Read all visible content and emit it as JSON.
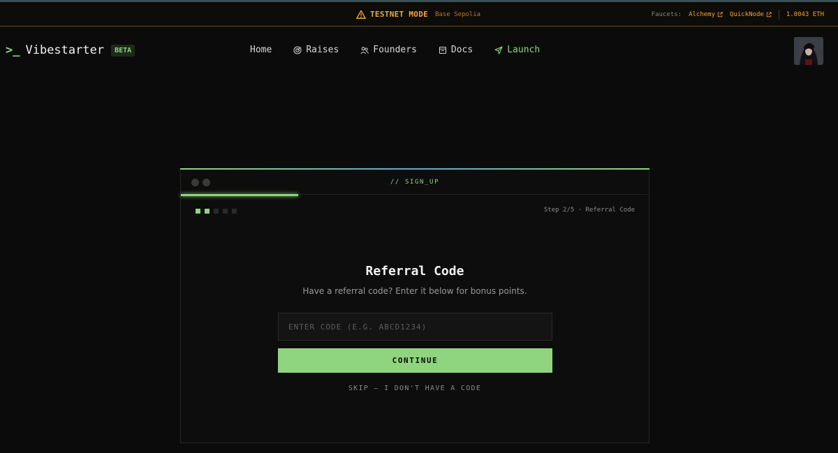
{
  "testnet": {
    "title": "TESTNET MODE",
    "network": "Base Sepolia",
    "faucets_label": "Faucets:",
    "faucets": [
      "Alchemy",
      "QuickNode"
    ],
    "balance": "1.0043 ETH"
  },
  "brand": {
    "prompt": ">_",
    "name": "Vibestarter",
    "badge": "BETA"
  },
  "nav": {
    "home": "Home",
    "raises": "Raises",
    "founders": "Founders",
    "docs": "Docs",
    "launch": "Launch"
  },
  "card": {
    "header_title": "// SIGN_UP",
    "step_label": "Step 2/5 · Referral Code",
    "steps_total": 5,
    "steps_done": 2,
    "heading": "Referral Code",
    "subtitle": "Have a referral code? Enter it below for bonus points.",
    "input_placeholder": "ENTER CODE (E.G. ABCD1234)",
    "input_value": "",
    "continue_label": "CONTINUE",
    "skip_label": "SKIP — I DON'T HAVE A CODE"
  },
  "colors": {
    "accent": "#8fd47f",
    "warning": "#f2a43a",
    "background": "#0b0b0b"
  },
  "icons": {
    "warning": "warning-triangle-icon",
    "external": "external-link-icon",
    "raises": "target-icon",
    "founders": "users-icon",
    "docs": "book-icon",
    "launch": "send-icon"
  }
}
